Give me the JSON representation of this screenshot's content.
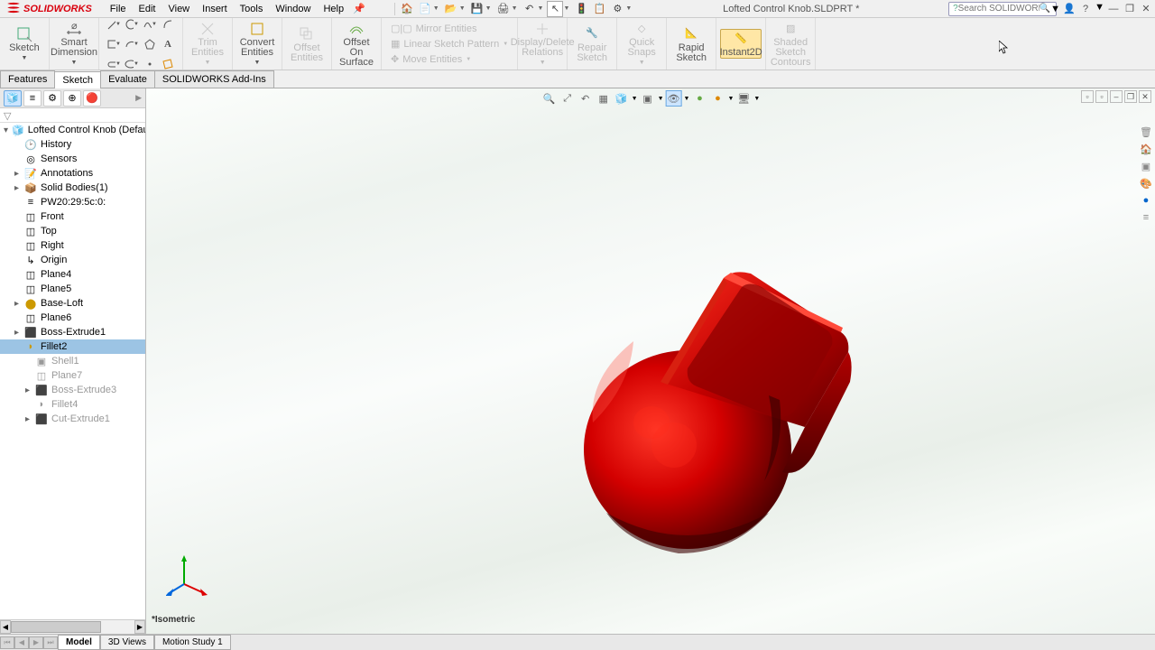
{
  "app": {
    "name": "SOLIDWORKS",
    "title": "Lofted Control Knob.SLDPRT *"
  },
  "menu": {
    "file": "File",
    "edit": "Edit",
    "view": "View",
    "insert": "Insert",
    "tools": "Tools",
    "window": "Window",
    "help": "Help"
  },
  "search": {
    "placeholder": "Search SOLIDWORKS Help"
  },
  "ribbon": {
    "sketch": "Sketch",
    "smart_dim": "Smart Dimension",
    "trim": "Trim Entities",
    "convert": "Convert Entities",
    "offset": "Offset Entities",
    "offset_on": "Offset On Surface",
    "mirror": "Mirror Entities",
    "lpattern": "Linear Sketch Pattern",
    "move": "Move Entities",
    "disp_del": "Display/Delete Relations",
    "repair": "Repair Sketch",
    "quick": "Quick Snaps",
    "rapid": "Rapid Sketch",
    "instant": "Instant2D",
    "shaded": "Shaded Sketch Contours"
  },
  "tabs": {
    "features": "Features",
    "sketch": "Sketch",
    "evaluate": "Evaluate",
    "addins": "SOLIDWORKS Add-Ins"
  },
  "tree": {
    "root": "Lofted Control Knob  (Default<<Default",
    "history": "History",
    "sensors": "Sensors",
    "annotations": "Annotations",
    "solid_bodies": "Solid Bodies(1)",
    "pw": "PW20:29:5c:0:",
    "front": "Front",
    "top": "Top",
    "right": "Right",
    "origin": "Origin",
    "plane4": "Plane4",
    "plane5": "Plane5",
    "base_loft": "Base-Loft",
    "plane6": "Plane6",
    "boss_ext1": "Boss-Extrude1",
    "fillet2": "Fillet2",
    "shell1": "Shell1",
    "plane7": "Plane7",
    "boss_ext3": "Boss-Extrude3",
    "fillet4": "Fillet4",
    "cut_ext1": "Cut-Extrude1"
  },
  "viewport": {
    "label": "*Isometric"
  },
  "bottom": {
    "model": "Model",
    "views": "3D Views",
    "motion": "Motion Study 1"
  }
}
